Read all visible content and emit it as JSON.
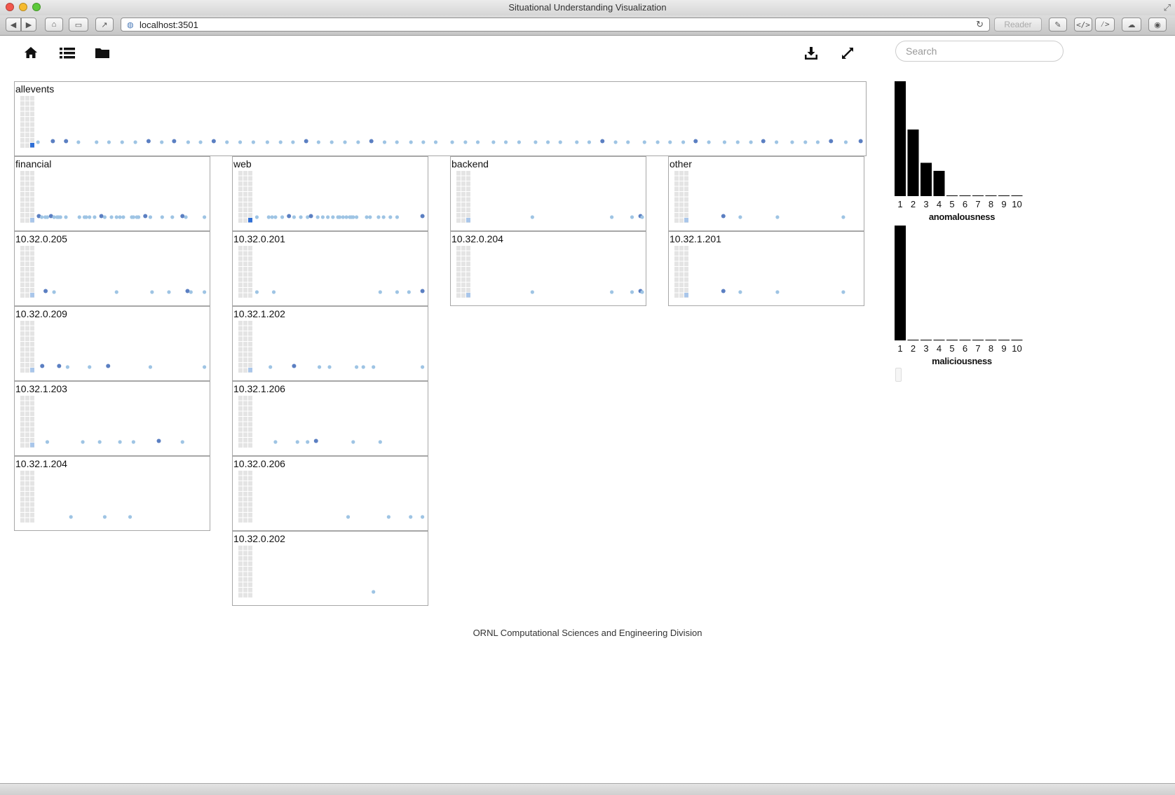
{
  "window": {
    "title": "Situational Understanding Visualization",
    "url": "localhost:3501",
    "reader_label": "Reader"
  },
  "header": {
    "icons": [
      "home-icon",
      "list-icon",
      "folder-icon",
      "download-icon",
      "fullscreen-icon"
    ],
    "search_placeholder": "Search",
    "search_value": ""
  },
  "colors": {
    "dot_light": "#9ec4e4",
    "dot_dark": "#5b7fc2",
    "grid_cell": "#e4e4e4",
    "mark_light": "#a9c6ea",
    "mark_dark": "#2f6fd6",
    "bar": "#000000"
  },
  "panels": [
    {
      "label": "allevents",
      "mark": "dark",
      "dots": [
        [
          0.001,
          0
        ],
        [
          0.019,
          1
        ],
        [
          0.035,
          1
        ],
        [
          0.05,
          0
        ],
        [
          0.072,
          0
        ],
        [
          0.087,
          0
        ],
        [
          0.103,
          0
        ],
        [
          0.119,
          0
        ],
        [
          0.135,
          1
        ],
        [
          0.151,
          0
        ],
        [
          0.166,
          1
        ],
        [
          0.183,
          0
        ],
        [
          0.198,
          0
        ],
        [
          0.214,
          1
        ],
        [
          0.23,
          0
        ],
        [
          0.246,
          0
        ],
        [
          0.262,
          0
        ],
        [
          0.279,
          0
        ],
        [
          0.295,
          0
        ],
        [
          0.31,
          0
        ],
        [
          0.326,
          1
        ],
        [
          0.341,
          0
        ],
        [
          0.357,
          0
        ],
        [
          0.373,
          0
        ],
        [
          0.389,
          0
        ],
        [
          0.405,
          1
        ],
        [
          0.421,
          0
        ],
        [
          0.436,
          0
        ],
        [
          0.453,
          0
        ],
        [
          0.468,
          0
        ],
        [
          0.483,
          0
        ],
        [
          0.503,
          0
        ],
        [
          0.519,
          0
        ],
        [
          0.534,
          0
        ],
        [
          0.553,
          0
        ],
        [
          0.568,
          0
        ],
        [
          0.584,
          0
        ],
        [
          0.604,
          0
        ],
        [
          0.619,
          0
        ],
        [
          0.634,
          0
        ],
        [
          0.654,
          0
        ],
        [
          0.669,
          0
        ],
        [
          0.685,
          1
        ],
        [
          0.701,
          0
        ],
        [
          0.716,
          0
        ],
        [
          0.736,
          0
        ],
        [
          0.752,
          0
        ],
        [
          0.767,
          0
        ],
        [
          0.783,
          0
        ],
        [
          0.798,
          1
        ],
        [
          0.814,
          0
        ],
        [
          0.833,
          0
        ],
        [
          0.849,
          0
        ],
        [
          0.865,
          0
        ],
        [
          0.88,
          1
        ],
        [
          0.896,
          0
        ],
        [
          0.915,
          0
        ],
        [
          0.931,
          0
        ],
        [
          0.946,
          0
        ],
        [
          0.962,
          1
        ],
        [
          0.98,
          0
        ],
        [
          0.998,
          1
        ]
      ]
    },
    {
      "label": "financial",
      "mark": "light",
      "dots": [
        [
          0.01,
          1
        ],
        [
          0.027,
          0
        ],
        [
          0.048,
          0
        ],
        [
          0.06,
          0
        ],
        [
          0.082,
          1
        ],
        [
          0.1,
          0
        ],
        [
          0.118,
          0
        ],
        [
          0.127,
          0
        ],
        [
          0.138,
          0
        ],
        [
          0.17,
          0
        ],
        [
          0.25,
          0
        ],
        [
          0.28,
          0
        ],
        [
          0.29,
          0
        ],
        [
          0.31,
          0
        ],
        [
          0.34,
          0
        ],
        [
          0.38,
          1
        ],
        [
          0.4,
          0
        ],
        [
          0.44,
          0
        ],
        [
          0.47,
          0
        ],
        [
          0.49,
          0
        ],
        [
          0.51,
          0
        ],
        [
          0.56,
          0
        ],
        [
          0.57,
          0
        ],
        [
          0.59,
          0
        ],
        [
          0.64,
          1
        ],
        [
          0.6,
          0
        ],
        [
          0.67,
          0
        ],
        [
          0.74,
          0
        ],
        [
          0.8,
          0
        ],
        [
          0.86,
          1
        ],
        [
          0.88,
          0
        ],
        [
          0.99,
          0
        ]
      ]
    },
    {
      "label": "10.32.0.205",
      "mark": "light",
      "dots": [
        [
          0.05,
          1
        ],
        [
          0.1,
          0
        ],
        [
          0.47,
          0
        ],
        [
          0.68,
          0
        ],
        [
          0.78,
          0
        ],
        [
          0.89,
          1
        ],
        [
          0.91,
          0
        ],
        [
          0.99,
          0
        ]
      ]
    },
    {
      "label": "10.32.0.209",
      "mark": "light",
      "dots": [
        [
          0.03,
          1
        ],
        [
          0.13,
          1
        ],
        [
          0.18,
          0
        ],
        [
          0.31,
          0
        ],
        [
          0.42,
          1
        ],
        [
          0.67,
          0
        ],
        [
          0.99,
          0
        ]
      ]
    },
    {
      "label": "10.32.1.203",
      "mark": "light",
      "dots": [
        [
          0.06,
          0
        ],
        [
          0.27,
          0
        ],
        [
          0.37,
          0
        ],
        [
          0.49,
          0
        ],
        [
          0.57,
          0
        ],
        [
          0.72,
          1
        ],
        [
          0.86,
          0
        ]
      ]
    },
    {
      "label": "10.32.1.204",
      "mark": "none",
      "dots": [
        [
          0.2,
          0
        ],
        [
          0.4,
          0
        ],
        [
          0.55,
          0
        ]
      ]
    },
    {
      "label": "web",
      "mark": "dark",
      "dots": [
        [
          0.01,
          0
        ],
        [
          0.08,
          0
        ],
        [
          0.1,
          0
        ],
        [
          0.12,
          0
        ],
        [
          0.16,
          0
        ],
        [
          0.2,
          1
        ],
        [
          0.23,
          0
        ],
        [
          0.27,
          0
        ],
        [
          0.31,
          0
        ],
        [
          0.33,
          1
        ],
        [
          0.37,
          0
        ],
        [
          0.4,
          0
        ],
        [
          0.43,
          0
        ],
        [
          0.46,
          0
        ],
        [
          0.49,
          0
        ],
        [
          0.5,
          0
        ],
        [
          0.52,
          0
        ],
        [
          0.54,
          0
        ],
        [
          0.56,
          0
        ],
        [
          0.57,
          0
        ],
        [
          0.58,
          0
        ],
        [
          0.6,
          0
        ],
        [
          0.66,
          0
        ],
        [
          0.68,
          0
        ],
        [
          0.73,
          0
        ],
        [
          0.76,
          0
        ],
        [
          0.8,
          0
        ],
        [
          0.84,
          0
        ],
        [
          0.99,
          1
        ]
      ]
    },
    {
      "label": "10.32.0.201",
      "mark": "none",
      "dots": [
        [
          0.01,
          0
        ],
        [
          0.11,
          0
        ],
        [
          0.74,
          0
        ],
        [
          0.84,
          0
        ],
        [
          0.91,
          0
        ],
        [
          0.99,
          1
        ]
      ]
    },
    {
      "label": "10.32.1.202",
      "mark": "light",
      "dots": [
        [
          0.09,
          0
        ],
        [
          0.23,
          1
        ],
        [
          0.38,
          0
        ],
        [
          0.44,
          0
        ],
        [
          0.6,
          0
        ],
        [
          0.64,
          0
        ],
        [
          0.7,
          0
        ],
        [
          0.99,
          0
        ]
      ]
    },
    {
      "label": "10.32.1.206",
      "mark": "none",
      "dots": [
        [
          0.12,
          0
        ],
        [
          0.25,
          0
        ],
        [
          0.31,
          0
        ],
        [
          0.36,
          1
        ],
        [
          0.58,
          0
        ],
        [
          0.74,
          0
        ]
      ]
    },
    {
      "label": "10.32.0.206",
      "mark": "none",
      "dots": [
        [
          0.55,
          0
        ],
        [
          0.79,
          0
        ],
        [
          0.92,
          0
        ],
        [
          0.99,
          0
        ]
      ]
    },
    {
      "label": "10.32.0.202",
      "mark": "none",
      "dots": [
        [
          0.7,
          0
        ]
      ]
    },
    {
      "label": "backend",
      "mark": "light",
      "dots": [
        [
          0.35,
          0
        ],
        [
          0.82,
          0
        ],
        [
          0.94,
          0
        ],
        [
          0.99,
          1
        ],
        [
          1.0,
          0
        ]
      ]
    },
    {
      "label": "10.32.0.204",
      "mark": "light",
      "dots": [
        [
          0.35,
          0
        ],
        [
          0.82,
          0
        ],
        [
          0.94,
          0
        ],
        [
          0.99,
          1
        ],
        [
          1.0,
          0
        ]
      ]
    },
    {
      "label": "other",
      "mark": "light",
      "dots": [
        [
          0.19,
          1
        ],
        [
          0.29,
          0
        ],
        [
          0.51,
          0
        ],
        [
          0.9,
          0
        ]
      ]
    },
    {
      "label": "10.32.1.201",
      "mark": "light",
      "dots": [
        [
          0.19,
          1
        ],
        [
          0.29,
          0
        ],
        [
          0.51,
          0
        ],
        [
          0.9,
          0
        ]
      ]
    }
  ],
  "chart_data": [
    {
      "type": "bar",
      "title": "anomalousness",
      "categories": [
        "1",
        "2",
        "3",
        "4",
        "5",
        "6",
        "7",
        "8",
        "9",
        "10"
      ],
      "values": [
        100,
        58,
        29,
        22,
        0,
        0,
        0,
        0,
        0,
        0
      ]
    },
    {
      "type": "bar",
      "title": "maliciousness",
      "categories": [
        "1",
        "2",
        "3",
        "4",
        "5",
        "6",
        "7",
        "8",
        "9",
        "10"
      ],
      "values": [
        100,
        0,
        0,
        0,
        0,
        0,
        0,
        0,
        0,
        0
      ]
    }
  ],
  "footer": {
    "text": "ORNL Computational Sciences and Engineering Division"
  }
}
